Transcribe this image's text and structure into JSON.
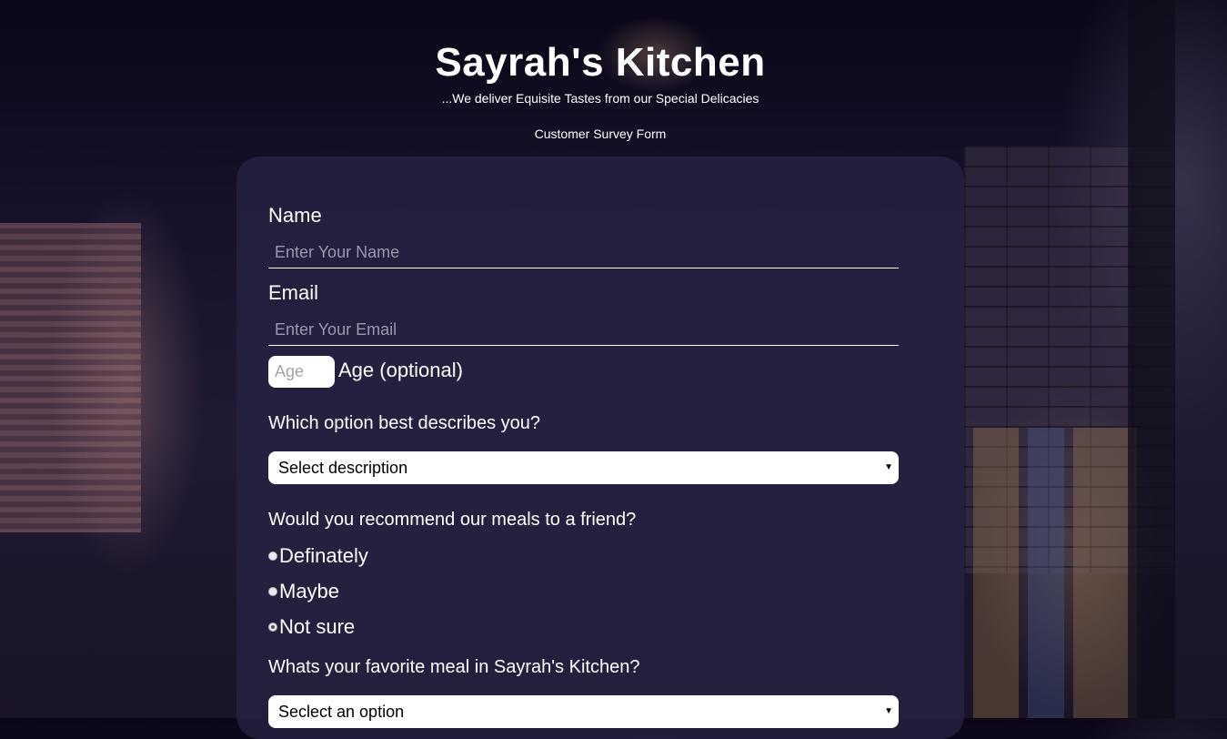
{
  "header": {
    "title": "Sayrah's Kitchen",
    "tagline": "...We deliver Equisite Tastes from our Special Delicacies",
    "subtitle": "Customer Survey Form"
  },
  "form": {
    "name": {
      "label": "Name",
      "placeholder": "Enter Your Name"
    },
    "email": {
      "label": "Email",
      "placeholder": "Enter Your Email"
    },
    "age": {
      "placeholder": "Age",
      "label": "Age (optional)"
    },
    "description": {
      "question": "Which option best describes you?",
      "selected": "Select description"
    },
    "recommend": {
      "question": "Would you recommend our meals to a friend?",
      "options": [
        {
          "label": "Definately",
          "checked": false
        },
        {
          "label": "Maybe",
          "checked": false
        },
        {
          "label": "Not sure",
          "checked": true
        }
      ]
    },
    "favorite": {
      "question": "Whats your favorite meal in Sayrah's Kitchen?",
      "selected": "Seclect an option"
    }
  },
  "icons": {
    "select_caret": "caret-down-icon"
  }
}
